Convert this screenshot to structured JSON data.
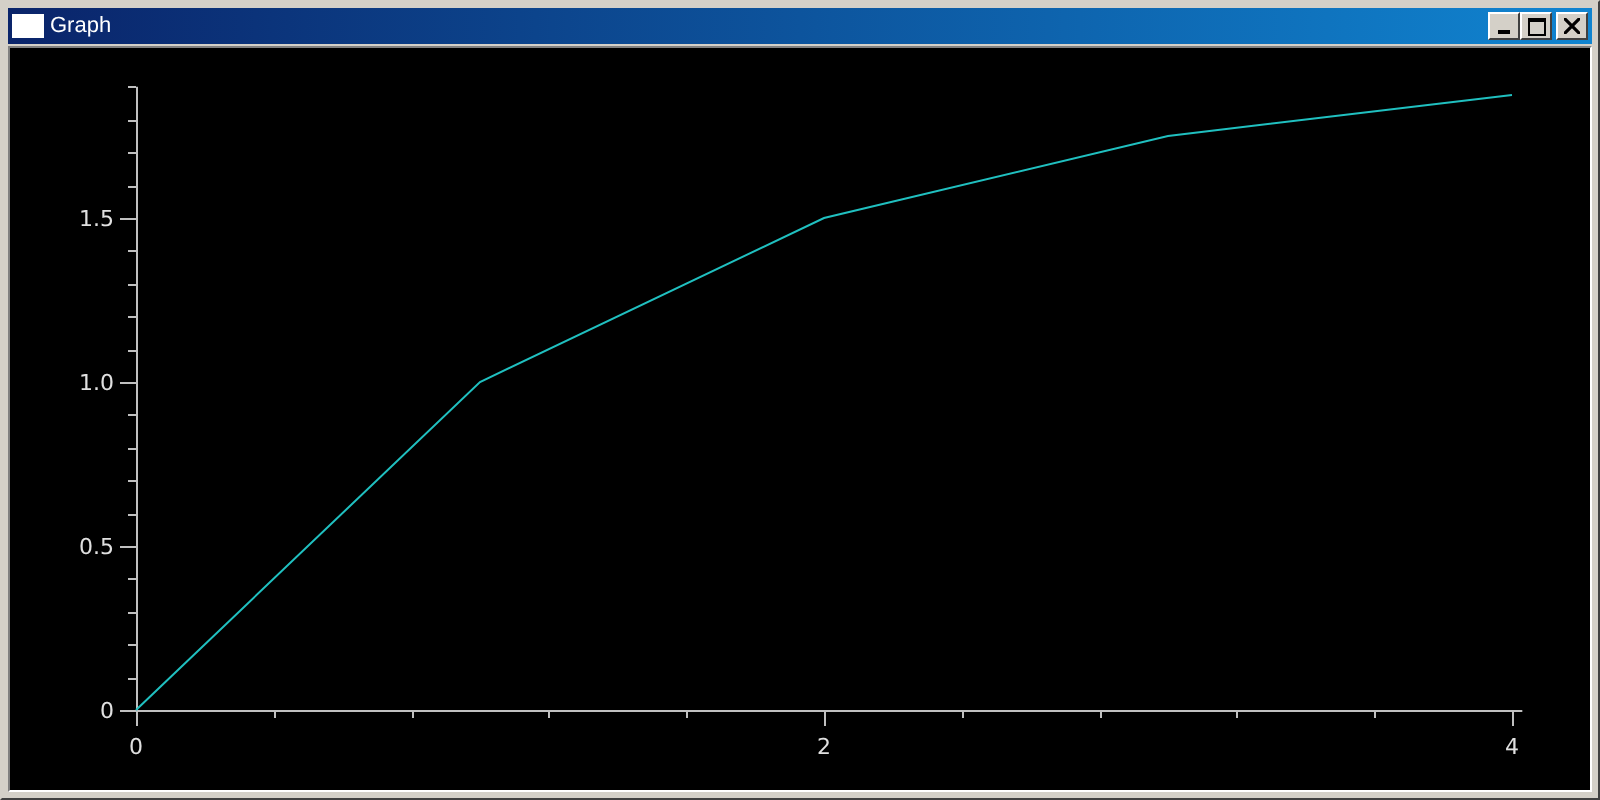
{
  "window": {
    "title": "Graph"
  },
  "plot": {
    "chart_data": {
      "type": "line",
      "x": [
        0,
        1,
        2,
        3,
        4
      ],
      "series": [
        {
          "color": "#20c0c0",
          "values": [
            0,
            1,
            1.5,
            1.75,
            1.875
          ]
        }
      ],
      "xlim": [
        0,
        4.03
      ],
      "ylim": [
        0,
        1.9
      ],
      "xticks": [
        0,
        2,
        4
      ],
      "yticks": [
        {
          "value": 0,
          "label": "0"
        },
        {
          "value": 0.5,
          "label": "0.5"
        },
        {
          "value": 1,
          "label": "1.0"
        },
        {
          "value": 1.5,
          "label": "1.5"
        }
      ]
    }
  }
}
